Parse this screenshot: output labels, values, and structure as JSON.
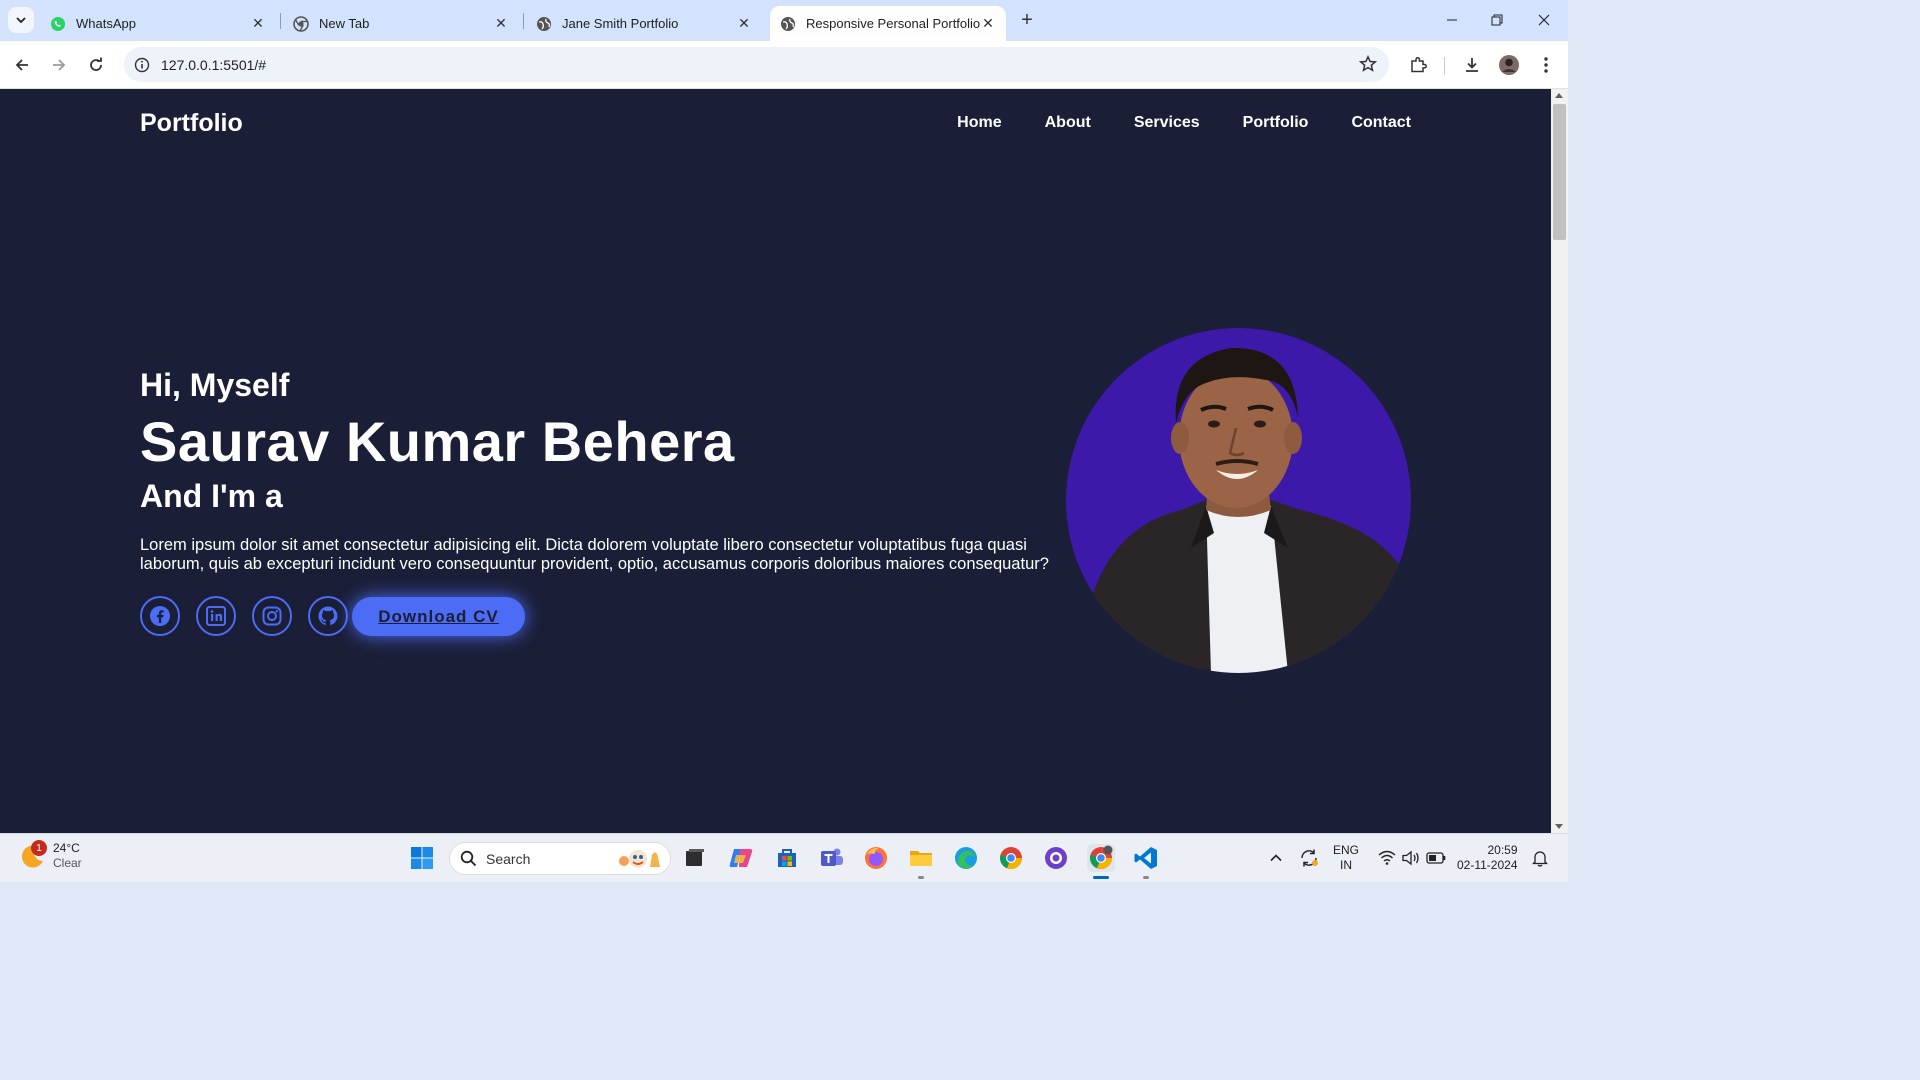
{
  "browser": {
    "tabs": [
      {
        "label": "WhatsApp",
        "icon": "whatsapp-icon"
      },
      {
        "label": "New Tab",
        "icon": "chrome-icon"
      },
      {
        "label": "Jane Smith Portfolio",
        "icon": "globe-icon"
      },
      {
        "label": "Responsive Personal Portfolio W",
        "icon": "globe-icon",
        "active": true
      }
    ],
    "url": "127.0.0.1:5501/#"
  },
  "site": {
    "logo": "Portfolio",
    "nav": [
      "Home",
      "About",
      "Services",
      "Portfolio",
      "Contact"
    ],
    "hero": {
      "greeting": "Hi, Myself",
      "name": "Saurav Kumar Behera",
      "role_prefix": "And I'm a",
      "description": "Lorem ipsum dolor sit amet consectetur adipisicing elit. Dicta dolorem voluptate libero consectetur voluptatibus fuga quasi laborum, quis ab excepturi incidunt vero consequuntur provident, optio, accusamus corporis doloribus maiores consequatur?",
      "socials": [
        "facebook-icon",
        "linkedin-icon",
        "instagram-icon",
        "github-icon"
      ],
      "cv_button": "Download CV"
    },
    "colors": {
      "background": "#1a1e36",
      "accent": "#4d6cf5",
      "avatar_bg": "#3c19a8"
    }
  },
  "taskbar": {
    "weather": {
      "badge": "1",
      "temp": "24°C",
      "condition": "Clear"
    },
    "search_placeholder": "Search",
    "lang": {
      "line1": "ENG",
      "line2": "IN"
    },
    "clock": {
      "time": "20:59",
      "date": "02-11-2024"
    }
  }
}
